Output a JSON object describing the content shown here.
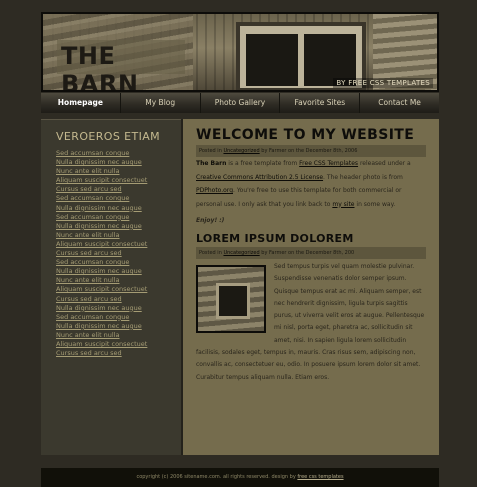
{
  "header": {
    "title": "THE BARN",
    "subtitle": "BY FREE CSS TEMPLATES"
  },
  "nav": {
    "items": [
      "Homepage",
      "My Blog",
      "Photo Gallery",
      "Favorite Sites",
      "Contact Me"
    ],
    "active": "Homepage"
  },
  "sidebar": {
    "title": "VEROEROS ETIAM",
    "links": [
      "Sed accumsan congue",
      "Nulla dignissim nec augue",
      "Nunc ante elit nulla",
      "Aliquam suscipit consectuet",
      "Cursus sed arcu sed",
      "Sed accumsan congue",
      "Nulla dignissim nec augue",
      "Sed accumsan congue",
      "Nulla dignissim nec augue",
      "Nunc ante elit nulla",
      "Aliquam suscipit consectuet",
      "Cursus sed arcu sed",
      "Sed accumsan congue",
      "Nulla dignissim nec augue",
      "Nunc ante elit nulla",
      "Aliquam suscipit consectuet",
      "Cursus sed arcu sed",
      "Nulla dignissim nec augue",
      "Sed accumsan congue",
      "Nulla dignissim nec augue",
      "Nunc ante elit nulla",
      "Aliquam suscipit consectuet",
      "Cursus sed arcu sed"
    ]
  },
  "post1": {
    "title": "WELCOME TO MY WEBSITE",
    "meta_posted": "Posted in",
    "meta_category": "Uncategorized",
    "meta_rest": "by Farmer on the December 8th, 2006",
    "p_strong": "The Barn",
    "p_1": " is a free template from ",
    "p_link1": "Free CSS Templates",
    "p_2": " released under a ",
    "p_link2": "Creative Commons Attribution 2.5 License",
    "p_3": ". The header photo is from ",
    "p_link3": "PDPhoto.org",
    "p_4": ". You're free to use this template for both commercial or personal use. I only ask that you link back to ",
    "p_link4": "my site",
    "p_5": " in some way.",
    "enjoy": "Enjoy! :)"
  },
  "post2": {
    "title": "LOREM IPSUM DOLOREM",
    "meta_posted": "Posted in",
    "meta_category": "Uncategorized",
    "meta_rest": "by Farmer on the December 8th, 200",
    "body": "Sed tempus turpis vel quam molestie pulvinar. Suspendisse venenatis dolor semper ipsum. Quisque tempus erat ac mi. Aliquam semper, est nec hendrerit dignissim, ligula turpis sagittis purus, ut viverra velit eros at augue. Pellentesque mi nisl, porta eget, pharetra ac, sollicitudin sit amet, nisi. In sapien ligula lorem sollicitudin facilisis, sodales eget, tempus in, mauris. Cras risus sem, adipiscing non, convallis ac, consectetuer eu, odio. In posuere ipsum lorem dolor sit amet. Curabitur tempus aliquam nulla. Etiam eros."
  },
  "footer": {
    "text": "copyright (c) 2006 sitename.com. all rights reserved. design by ",
    "link": "free css templates"
  }
}
